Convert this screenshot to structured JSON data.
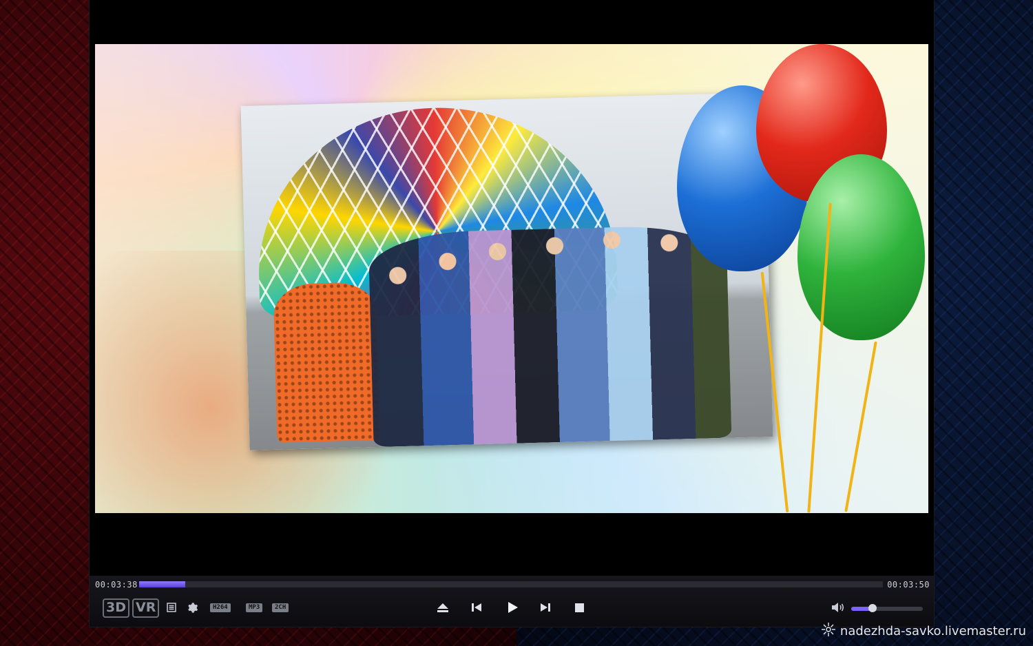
{
  "player": {
    "current_time": "00:03:38",
    "total_time": "00:03:50",
    "progress_fraction": 0.062,
    "volume_fraction": 0.3,
    "badges": {
      "three_d": "3D",
      "vr": "VR"
    },
    "codecs": [
      "H264",
      "MP3",
      "2CH"
    ],
    "icons": {
      "playlist": "playlist-icon",
      "settings": "gear-icon",
      "eject": "eject-icon",
      "previous": "skip-previous-icon",
      "play": "play-icon",
      "next": "skip-next-icon",
      "stop": "stop-icon",
      "volume": "speaker-icon"
    },
    "accent_color": "#6b52e8"
  },
  "watermark": {
    "text": "nadezhda-savko.livemaster.ru",
    "icon": "livemaster-logo-icon"
  }
}
